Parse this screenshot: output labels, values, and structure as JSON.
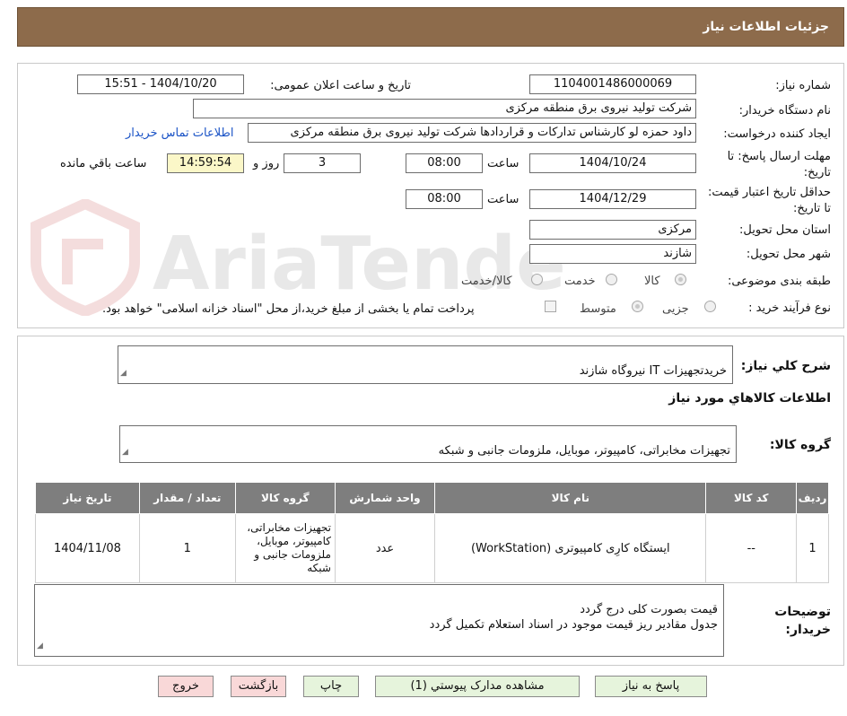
{
  "header": {
    "title": "جزئیات اطلاعات نیاز"
  },
  "watermark": {
    "text": "AriaTender.neT"
  },
  "form": {
    "need_number_label": "شماره نیاز:",
    "need_number": "1104001486000069",
    "announce_label": "تاریخ و ساعت اعلان عمومی:",
    "announce_value": "1404/10/20 - 15:51",
    "buyer_org_label": "نام دستگاه خریدار:",
    "buyer_org": "شرکت تولید نیروی برق منطقه مرکزی",
    "creator_label": "ایجاد کننده درخواست:",
    "creator": "داود حمزه لو کارشناس تدارکات و قراردادها شرکت تولید نیروی برق منطقه مرکزی",
    "contact_link": "اطلاعات تماس خریدار",
    "deadline_label": "مهلت ارسال پاسخ: تا تاریخ:",
    "deadline_date": "1404/10/24",
    "time_label": "ساعت",
    "deadline_time": "08:00",
    "days_value": "3",
    "days_label": "روز و",
    "remaining_time": "14:59:54",
    "remaining_label": "ساعت باقي مانده",
    "validity_label": "حداقل تاریخ اعتبار قیمت: تا تاریخ:",
    "validity_date": "1404/12/29",
    "validity_time": "08:00",
    "province_label": "استان محل تحویل:",
    "province": "مرکزی",
    "city_label": "شهر محل تحویل:",
    "city": "شازند",
    "category_label": "طبقه بندی موضوعی:",
    "category_options": [
      "کالا",
      "خدمت",
      "کالا/خدمت"
    ],
    "process_label": "نوع فرآیند خرید :",
    "process_options": [
      "جزیی",
      "متوسط"
    ],
    "payment_note": "پرداخت تمام یا بخشی از مبلغ خرید،از محل \"اسناد خزانه اسلامی\" خواهد بود."
  },
  "summary": {
    "label": "شرح کلي نیاز:",
    "text": "خریدتجهیزات IT  نیروگاه شازند",
    "goods_info_title": "اطلاعات کالاهاي مورد نیاز",
    "group_label": "گروه کالا:",
    "group_text": "تجهیزات مخابراتی، کامپیوتر، موبایل، ملزومات جانبی و شبکه"
  },
  "table": {
    "headers": [
      "ردیف",
      "کد کالا",
      "نام کالا",
      "واحد شمارش",
      "گروه کالا",
      "تعداد / مقدار",
      "تاریخ نیاز"
    ],
    "rows": [
      [
        "1",
        "--",
        "ایستگاه کارِی کامپیوتری (WorkStation)",
        "عدد",
        "تجهیزات مخابراتی، کامپیوتر، موبایل، ملزومات جانبی و شبکه",
        "1",
        "1404/11/08"
      ]
    ]
  },
  "notes": {
    "label": "توضیحات خریدار:",
    "text": "قیمت بصورت کلی درج گردد\nجدول مقادیر ریز قیمت موجود در اسناد استعلام تکمیل گردد"
  },
  "buttons": {
    "reply": "پاسخ به نیاز",
    "attachments": "مشاهده مدارک پیوستي (1)",
    "print": "چاپ",
    "back": "بازگشت",
    "exit": "خروج"
  }
}
